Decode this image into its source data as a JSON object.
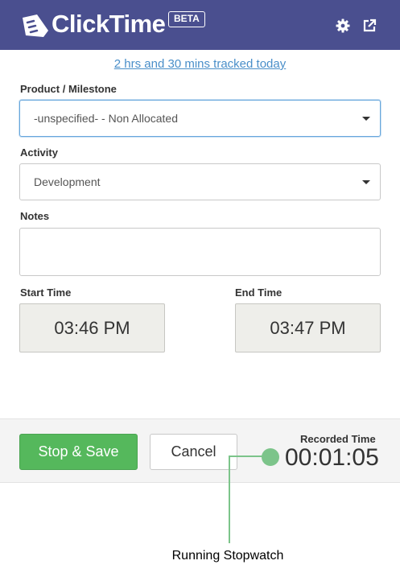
{
  "header": {
    "brand": "ClickTime",
    "badge": "BETA",
    "icons": [
      "gear-icon",
      "popout-icon"
    ],
    "bg_color": "#4a4f8f"
  },
  "tracked_link": "2 hrs and 30 mins tracked today",
  "form": {
    "product_label": "Product / Milestone",
    "product_value": "-unspecified- - Non Allocated",
    "activity_label": "Activity",
    "activity_value": "Development",
    "notes_label": "Notes",
    "notes_value": "",
    "start_label": "Start Time",
    "start_value": "03:46 PM",
    "end_label": "End Time",
    "end_value": "03:47 PM"
  },
  "footer": {
    "save_label": "Stop & Save",
    "cancel_label": "Cancel",
    "recorded_label": "Recorded Time",
    "recorded_value": "00:01:05",
    "save_color": "#55b85c"
  },
  "annotation": {
    "text": "Running Stopwatch",
    "color": "#7cc48a"
  }
}
